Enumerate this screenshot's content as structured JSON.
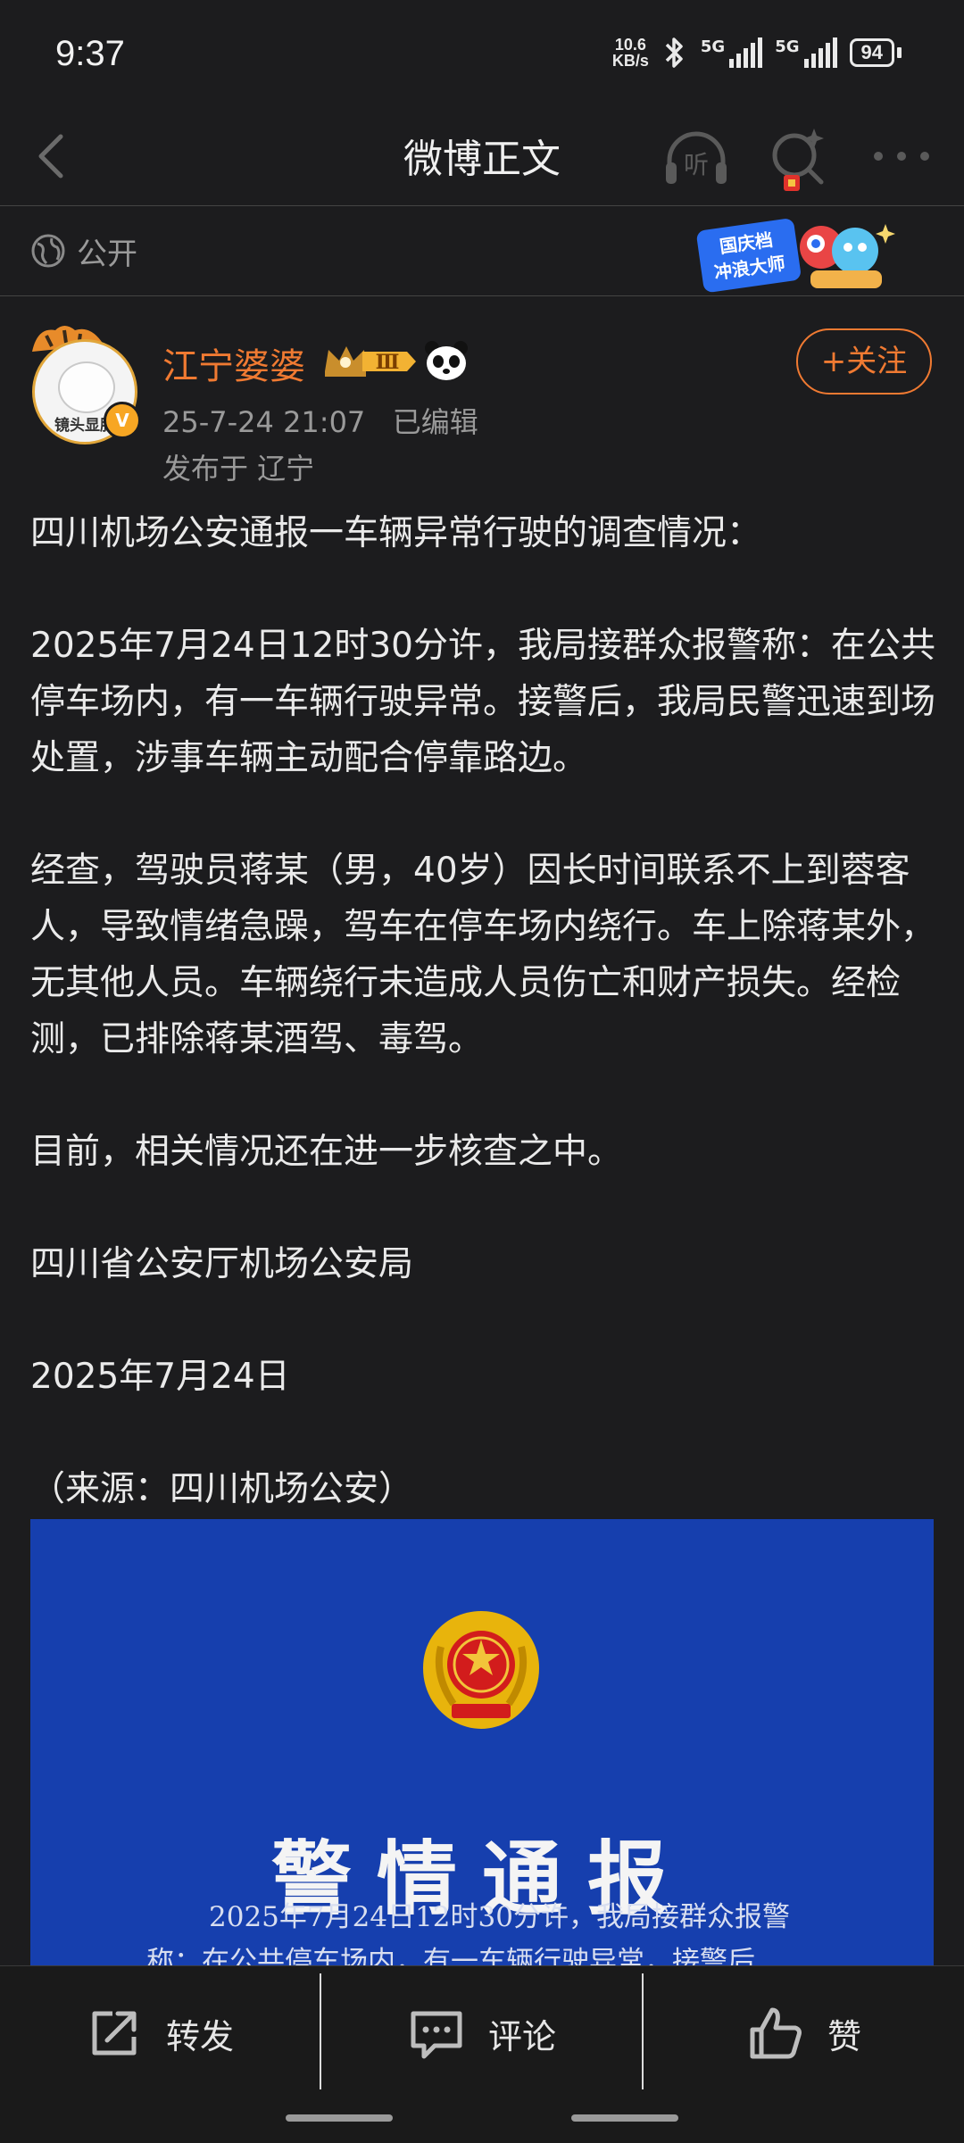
{
  "status_bar": {
    "time": "9:37",
    "net_speed_value": "10.6",
    "net_speed_unit": "KB/s",
    "sim1_label": "5G",
    "sim2_label": "5G",
    "battery": "94"
  },
  "nav": {
    "title": "微博正文",
    "listen_icon_label": "听"
  },
  "visibility": {
    "label": "公开",
    "banner_line1": "国庆档",
    "banner_line2": "冲浪大师"
  },
  "author": {
    "name": "江宁婆婆",
    "level_badge": "Ⅲ",
    "avatar_caption": "镜头显胖",
    "verified_badge": "V",
    "follow_label": "+关注",
    "timestamp": "25-7-24 21:07",
    "edited": "已编辑",
    "location": "发布于 辽宁"
  },
  "post": {
    "paragraphs": [
      "四川机场公安通报一车辆异常行驶的调查情况：",
      "2025年7月24日12时30分许，我局接群众报警称：在公共停车场内，有一车辆行驶异常。接警后，我局民警迅速到场处置，涉事车辆主动配合停靠路边。",
      "经查，驾驶员蒋某（男，40岁）因长时间联系不上到蓉客人，导致情绪急躁，驾车在停车场内绕行。车上除蒋某外，无其他人员。车辆绕行未造成人员伤亡和财产损失。经检测，已排除蒋某酒驾、毒驾。",
      "目前，相关情况还在进一步核查之中。",
      "四川省公安厅机场公安局",
      "2025年7月24日",
      "（来源：四川机场公安）"
    ]
  },
  "notice_image": {
    "title": "警情通报",
    "line1": "2025年7月24日12时30分许，我局接群众报警",
    "line2": "称：在公共停车场内，有一车辆行驶异常，接警后"
  },
  "actions": {
    "repost": "转发",
    "comment": "评论",
    "like": "赞"
  }
}
